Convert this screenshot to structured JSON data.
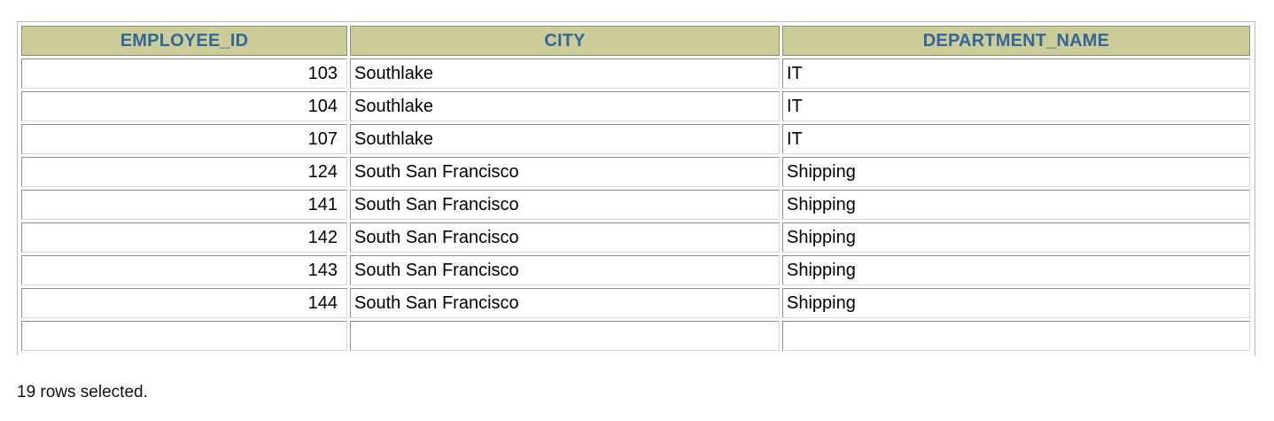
{
  "table": {
    "columns": [
      "EMPLOYEE_ID",
      "CITY",
      "DEPARTMENT_NAME"
    ],
    "rows": [
      [
        "103",
        "Southlake",
        "IT"
      ],
      [
        "104",
        "Southlake",
        "IT"
      ],
      [
        "107",
        "Southlake",
        "IT"
      ],
      [
        "124",
        "South San Francisco",
        "Shipping"
      ],
      [
        "141",
        "South San Francisco",
        "Shipping"
      ],
      [
        "142",
        "South San Francisco",
        "Shipping"
      ],
      [
        "143",
        "South San Francisco",
        "Shipping"
      ],
      [
        "144",
        "South San Francisco",
        "Shipping"
      ],
      [
        "",
        "",
        ""
      ]
    ]
  },
  "status": "19 rows selected.",
  "colors": {
    "header_bg": "#cccc99",
    "header_text": "#336699"
  }
}
